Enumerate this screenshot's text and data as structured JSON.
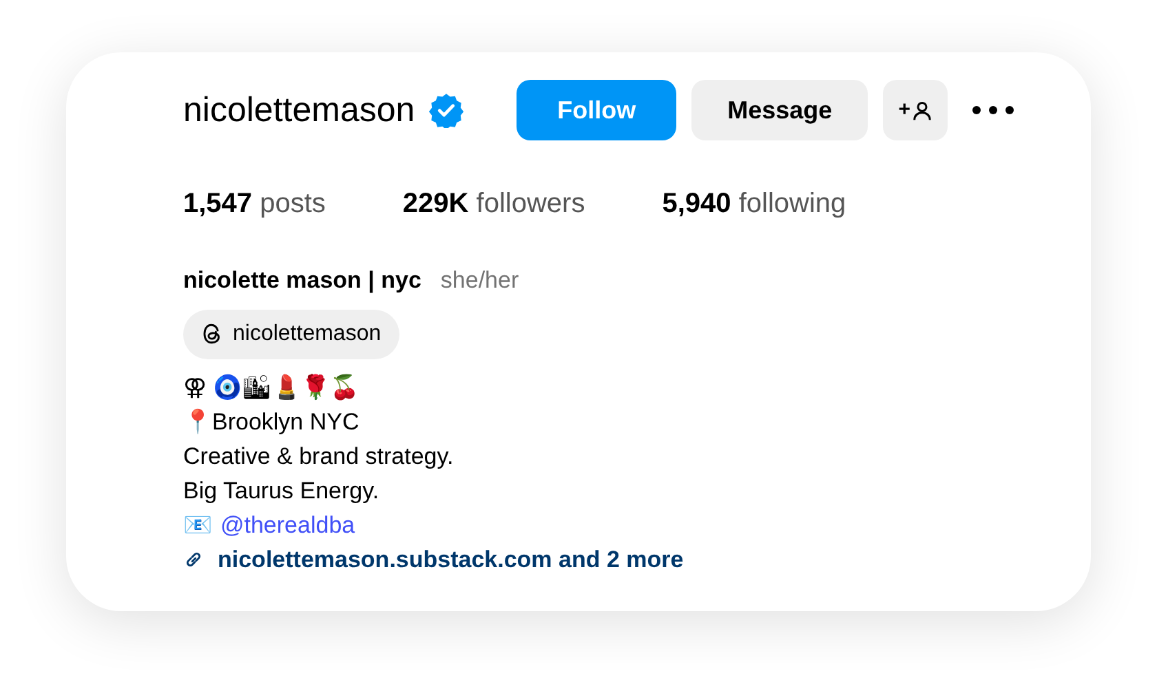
{
  "profile": {
    "username": "nicolettemason",
    "verified": true
  },
  "actions": [
    {
      "kind": "primary",
      "label": "Follow"
    },
    {
      "kind": "secondary",
      "label": "Message"
    },
    {
      "kind": "add-person",
      "label": "+"
    }
  ],
  "stats": [
    "**1,547** posts",
    "**229K** followers",
    "**5,940** following"
  ],
  "bio": {
    "name": "nicolette mason | nyc",
    "pronouns": "she/her",
    "threads": "nicolettemason",
    "lines": [
      {
        "kind": "text",
        "text": "⚢ 🧿🏙💄🌹🍒"
      },
      {
        "kind": "text",
        "text": "📍Brooklyn NYC"
      },
      {
        "kind": "text",
        "text": "Creative & brand strategy."
      },
      {
        "kind": "text",
        "text": "Big Taurus Energy."
      },
      {
        "kind": "mention",
        "prefix": "📧",
        "text": "@therealdba"
      }
    ],
    "link": "nicolettemason.substack.com and 2 more"
  }
}
